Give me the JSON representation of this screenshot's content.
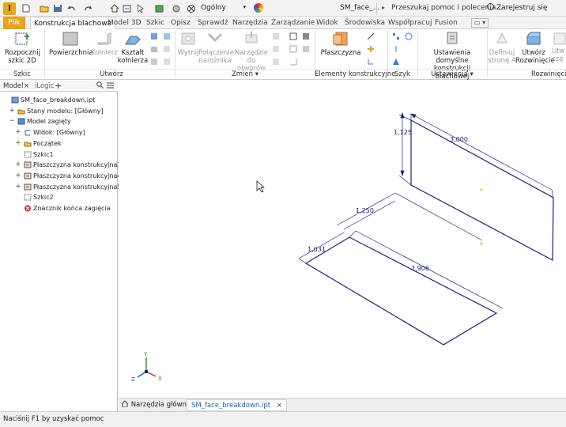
{
  "titlebar": {
    "workspace": "Ogólny",
    "document_title": "SM_face_...",
    "search_placeholder": "Przeszukaj pomoc i polecenia...",
    "signin": "Zarejestruj się"
  },
  "ribbon_tabs": {
    "file": "Plik",
    "tabs": [
      "Konstrukcja blachowa",
      "Model 3D",
      "Szkic",
      "Opisz",
      "Sprawdź",
      "Narzędzia",
      "Zarządzanie",
      "Widok",
      "Środowiska",
      "Współpracuj",
      "Fusion"
    ]
  },
  "ribbon": {
    "start_sketch": "Rozpocznij\nszkic 2D",
    "face": "Powierzchnia",
    "flange": "Kołnierz",
    "contour_flange": "Kształt\nkołnierza",
    "cut": "Wytnij",
    "corner_seam": "Połączenie\nnarożnika",
    "punch_tool": "Narzędzie\ndo otworów",
    "plane": "Płaszczyzna",
    "sheet_defaults": "Ustawienia domyślne\nkonstrukcji blachowej",
    "define_a_side": "Definiuj\nstronę A",
    "create_flat": "Utwórz\nRozwinięcie",
    "create_more": "Utw\nczę",
    "panel_sketch": "Szkic",
    "panel_create": "Utwórz",
    "panel_modify": "Zmień",
    "panel_work": "Elementy konstrukcyjne",
    "panel_pattern": "Szyk",
    "panel_setup": "Ustawienia",
    "panel_flat": "Rozwinięci"
  },
  "browser": {
    "tab_model": "Model",
    "tab_ilogic": "iLogic",
    "items": [
      {
        "label": "SM_face_breakdown.ipt",
        "level": 0,
        "exp": ""
      },
      {
        "label": "Stany modelu: [Główny]",
        "level": 1,
        "exp": "+"
      },
      {
        "label": "Model zagięty",
        "level": 1,
        "exp": "−"
      },
      {
        "label": "Widok: [Główny]",
        "level": 2,
        "exp": "+"
      },
      {
        "label": "Początek",
        "level": 2,
        "exp": "+"
      },
      {
        "label": "Szkic1",
        "level": 2,
        "exp": ""
      },
      {
        "label": "Płaszczyzna konstrukcyjna1",
        "level": 2,
        "exp": "+"
      },
      {
        "label": "Płaszczyzna konstrukcyjna4",
        "level": 2,
        "exp": "+"
      },
      {
        "label": "Płaszczyzna konstrukcyjna5",
        "level": 2,
        "exp": "+"
      },
      {
        "label": "Szkic2",
        "level": 2,
        "exp": ""
      },
      {
        "label": "Znacznik końca zagięcia",
        "level": 2,
        "exp": ""
      }
    ]
  },
  "viewport": {
    "dims": [
      "1,125",
      "3,000",
      "1,250",
      "1,031",
      "2,906"
    ],
    "axes": {
      "x": "X",
      "y": "Y",
      "z": "Z"
    }
  },
  "doc_tabs": {
    "home": "Narzędzia główne",
    "doc": "SM_face_breakdown.ipt"
  },
  "status": "Naciśnij F1 by uzyskać pomoc"
}
